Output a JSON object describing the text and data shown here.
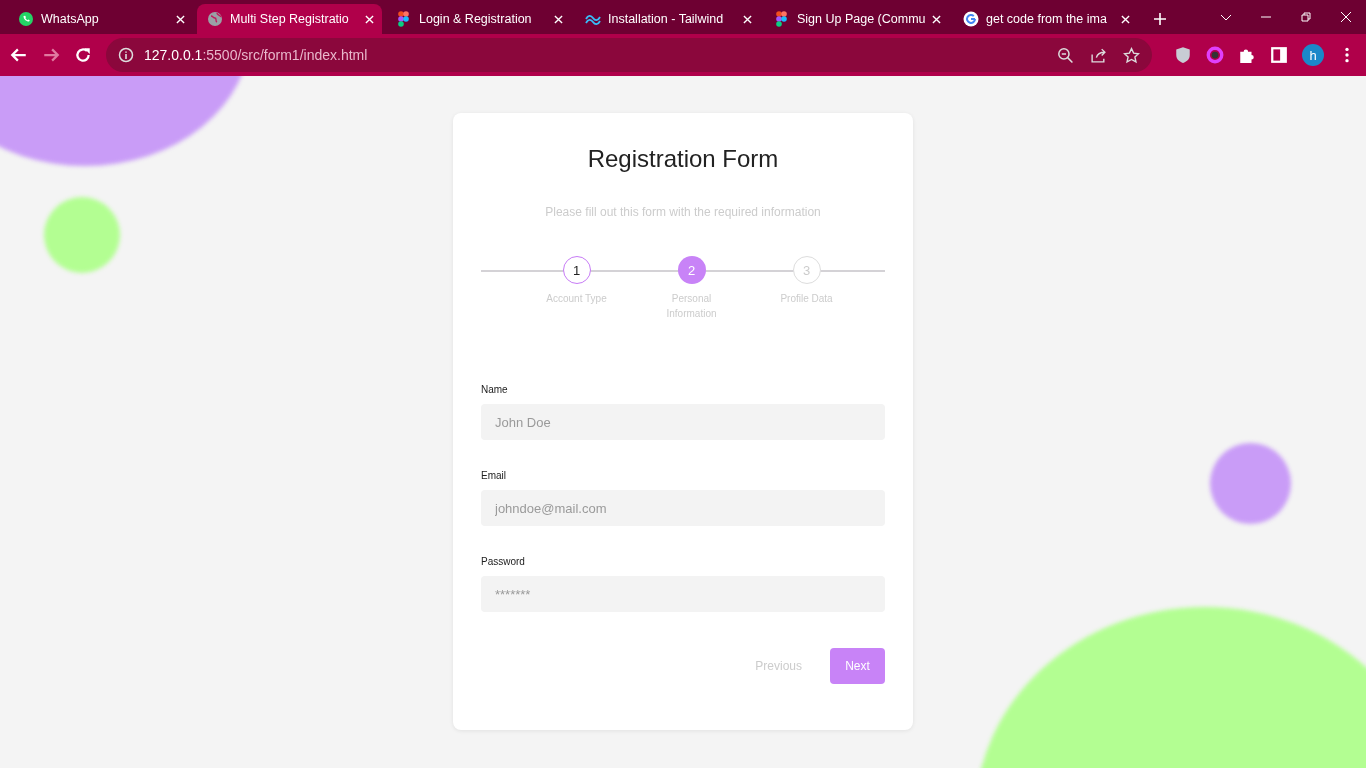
{
  "browser": {
    "tabs": [
      {
        "title": "WhatsApp",
        "kind": "whatsapp",
        "selected": false
      },
      {
        "title": "Multi Step Registratio",
        "kind": "globe",
        "selected": true
      },
      {
        "title": "Login & Registration",
        "kind": "figma",
        "selected": false
      },
      {
        "title": "Installation - Tailwind",
        "kind": "tailwind",
        "selected": false
      },
      {
        "title": "Sign Up Page (Commu",
        "kind": "figma",
        "selected": false
      },
      {
        "title": "get code from the ima",
        "kind": "google",
        "selected": false
      }
    ],
    "address": {
      "host": "127.0.0.1",
      "path": ":5500/src/form1/index.html"
    },
    "profile_initial": "h"
  },
  "form": {
    "title": "Registration Form",
    "subtitle": "Please fill out this form with the required information",
    "steps": [
      {
        "number": "1",
        "label": "Account Type",
        "completed": true,
        "selected": false
      },
      {
        "number": "2",
        "label": "Personal Information",
        "completed": false,
        "selected": true
      },
      {
        "number": "3",
        "label": "Profile Data",
        "completed": false,
        "selected": false
      }
    ],
    "fields": [
      {
        "label": "Name",
        "placeholder": "John Doe"
      },
      {
        "label": "Email",
        "placeholder": "johndoe@mail.com"
      },
      {
        "label": "Password",
        "placeholder": "*******"
      }
    ],
    "buttons": {
      "previous": "Previous",
      "next": "Next"
    }
  }
}
